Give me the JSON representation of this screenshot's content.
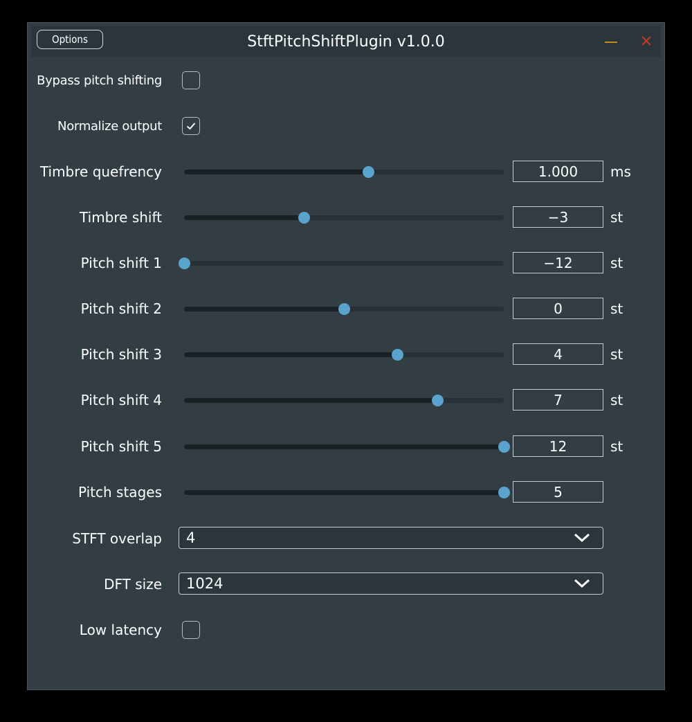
{
  "window": {
    "title": "StftPitchShiftPlugin v1.0.0",
    "options_label": "Options"
  },
  "bypass": {
    "label": "Bypass pitch shifting",
    "checked": false
  },
  "normalize": {
    "label": "Normalize output",
    "checked": true
  },
  "sliders": [
    {
      "name": "timbre-quefrency",
      "label": "Timbre quefrency",
      "value": "1.000",
      "unit": "ms",
      "fraction": 0.575
    },
    {
      "name": "timbre-shift",
      "label": "Timbre shift",
      "value": "−3",
      "unit": "st",
      "fraction": 0.375
    },
    {
      "name": "pitch-shift-1",
      "label": "Pitch shift 1",
      "value": "−12",
      "unit": "st",
      "fraction": 0.0
    },
    {
      "name": "pitch-shift-2",
      "label": "Pitch shift 2",
      "value": "0",
      "unit": "st",
      "fraction": 0.5
    },
    {
      "name": "pitch-shift-3",
      "label": "Pitch shift 3",
      "value": "4",
      "unit": "st",
      "fraction": 0.667
    },
    {
      "name": "pitch-shift-4",
      "label": "Pitch shift 4",
      "value": "7",
      "unit": "st",
      "fraction": 0.792
    },
    {
      "name": "pitch-shift-5",
      "label": "Pitch shift 5",
      "value": "12",
      "unit": "st",
      "fraction": 1.0
    },
    {
      "name": "pitch-stages",
      "label": "Pitch stages",
      "value": "5",
      "unit": "",
      "fraction": 1.0
    }
  ],
  "stft_overlap": {
    "label": "STFT overlap",
    "value": "4"
  },
  "dft_size": {
    "label": "DFT size",
    "value": "1024"
  },
  "low_latency": {
    "label": "Low latency",
    "checked": false
  },
  "colors": {
    "accent": "#5aa3cc",
    "background": "#323e44",
    "minimize": "#c98b14",
    "close": "#c0392b"
  }
}
